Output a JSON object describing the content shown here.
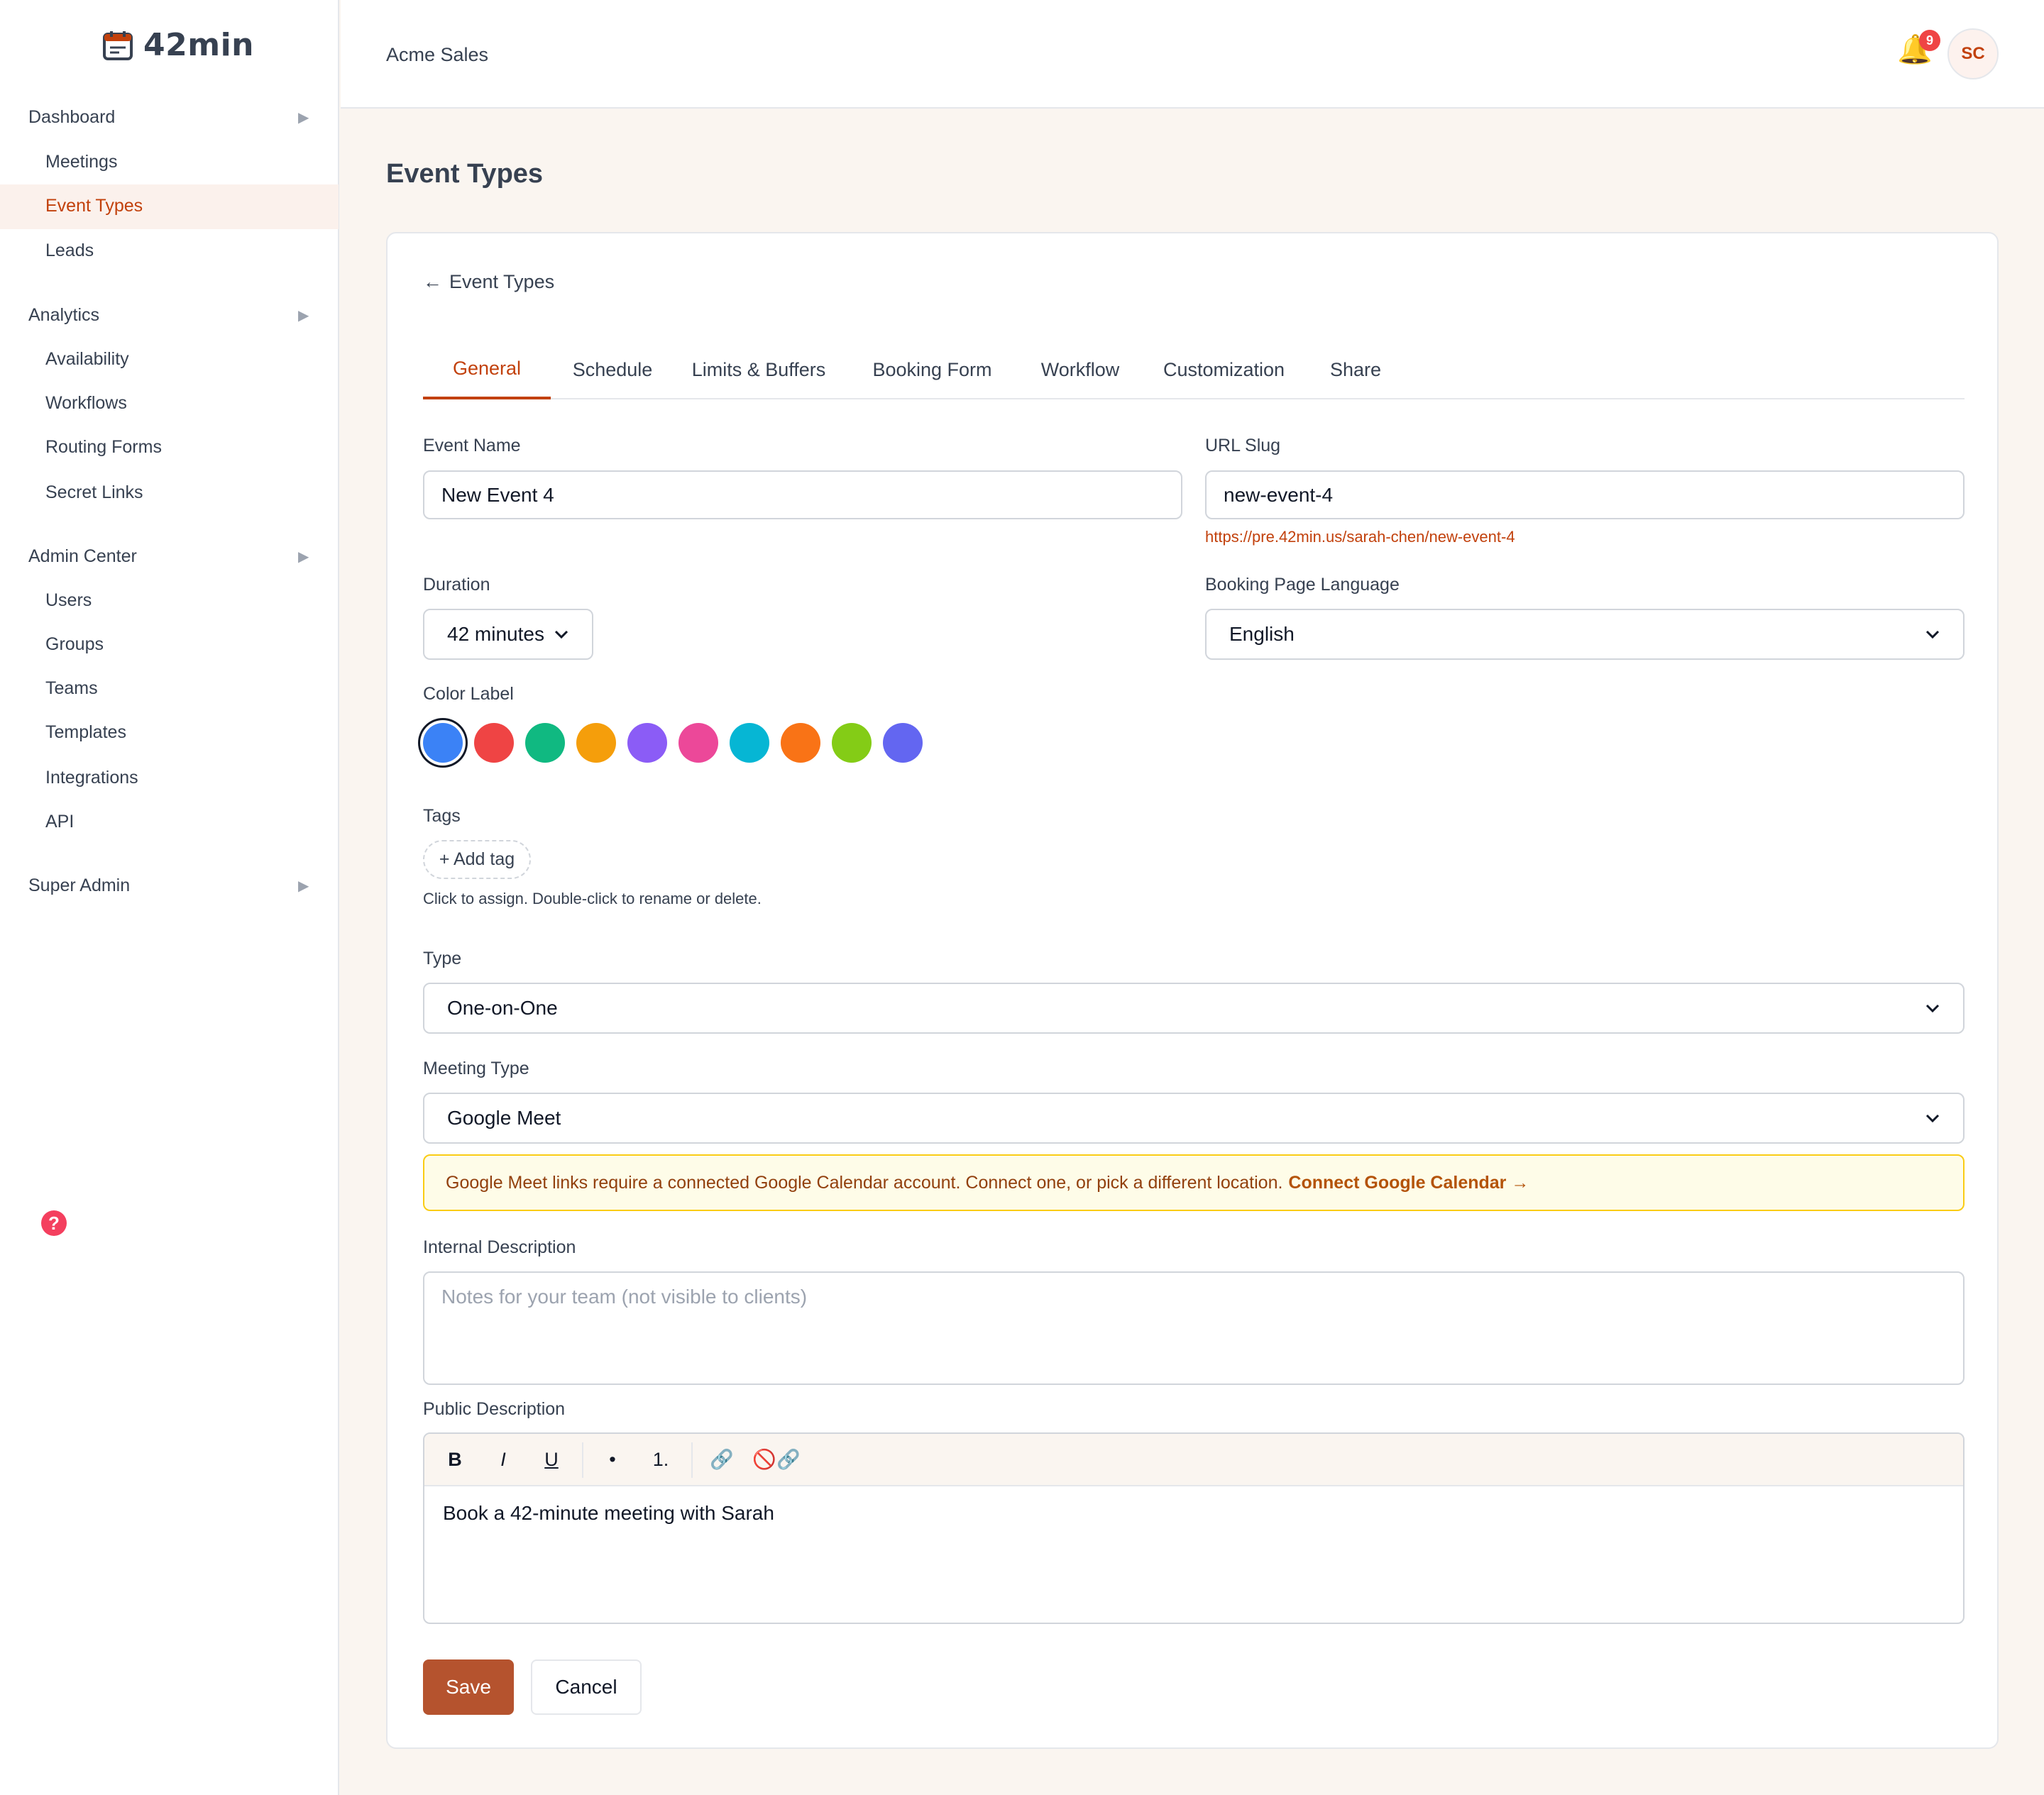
{
  "brand": {
    "name": "42min",
    "icon": "calendar-icon"
  },
  "sidebar": {
    "groups": [
      {
        "label": "Dashboard",
        "items": [
          "Meetings",
          "Event Types",
          "Leads"
        ]
      },
      {
        "label": "Analytics",
        "items": [
          "Availability",
          "Workflows",
          "Routing Forms",
          "Secret Links"
        ]
      },
      {
        "label": "Admin Center",
        "items": [
          "Users",
          "Groups",
          "Teams",
          "Templates",
          "Integrations",
          "API"
        ]
      },
      {
        "label": "Super Admin",
        "items": []
      }
    ],
    "active_item": "Event Types",
    "arrow": "▶",
    "help_icon": "?"
  },
  "topbar": {
    "org": "Acme Sales",
    "notification_count": "9",
    "avatar_initials": "SC",
    "bell_icon": "🔔"
  },
  "page": {
    "title": "Event Types"
  },
  "card": {
    "back_arrow": "←",
    "back_label": "Event Types",
    "tabs": [
      "General",
      "Schedule",
      "Limits & Buffers",
      "Booking Form",
      "Workflow",
      "Customization",
      "Share"
    ],
    "active_tab": "General",
    "fields": {
      "event_name": {
        "label": "Event Name",
        "value": "New Event 4"
      },
      "url_slug": {
        "label": "URL Slug",
        "value": "new-event-4",
        "hint": "https://pre.42min.us/sarah-chen/new-event-4"
      },
      "duration": {
        "label": "Duration",
        "value": "42 minutes"
      },
      "language": {
        "label": "Booking Page Language",
        "value": "English"
      },
      "color_label": {
        "label": "Color Label",
        "colors": [
          "#3b82f6",
          "#ef4444",
          "#10b981",
          "#f59e0b",
          "#8b5cf6",
          "#ec4899",
          "#06b6d4",
          "#f97316",
          "#84cc16",
          "#6366f1"
        ],
        "selected": "#3b82f6"
      },
      "tags": {
        "label": "Tags",
        "add_label": "+ Add tag",
        "hint": "Click to assign. Double-click to rename or delete."
      },
      "type": {
        "label": "Type",
        "value": "One-on-One"
      },
      "meeting_type": {
        "label": "Meeting Type",
        "value": "Google Meet"
      },
      "warning": {
        "text": "Google Meet links require a connected Google Calendar account. Connect one, or pick a different location.",
        "link": "Connect Google Calendar →"
      },
      "internal_description": {
        "label": "Internal Description",
        "placeholder": "Notes for your team (not visible to clients)"
      },
      "public_description": {
        "label": "Public Description",
        "value": "Book a 42-minute meeting with Sarah",
        "toolbar": [
          "B",
          "I",
          "U",
          "•",
          "1.",
          "🔗",
          "🚫🔗"
        ]
      }
    },
    "buttons": {
      "save": "Save",
      "cancel": "Cancel"
    }
  }
}
